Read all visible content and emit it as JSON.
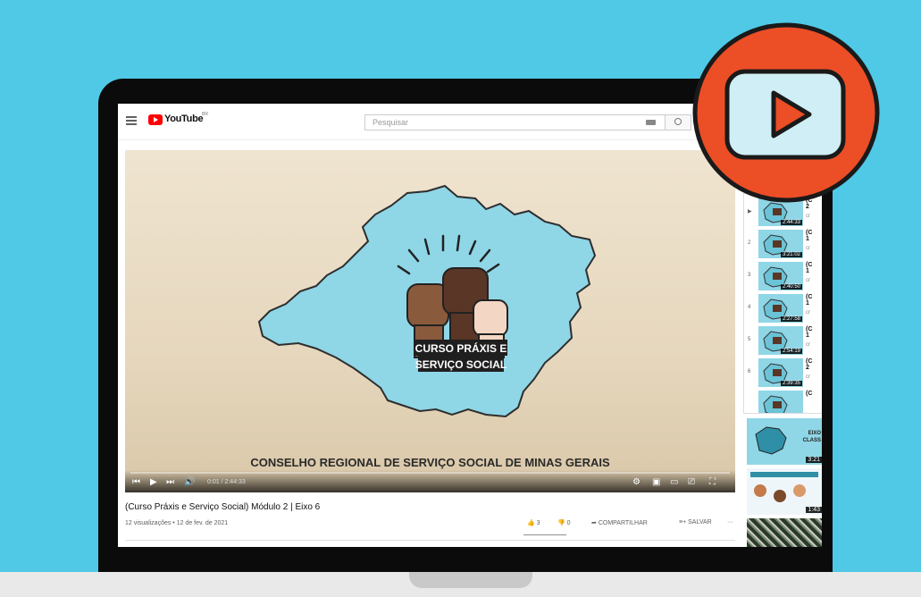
{
  "topbar": {
    "logo_text": "YouTube",
    "country_code": "BR",
    "search_placeholder": "Pesquisar"
  },
  "video": {
    "logo_text_line1": "CURSO PRÁXIS E",
    "logo_text_line2": "SERVIÇO SOCIAL",
    "caption": "CONSELHO REGIONAL DE SERVIÇO SOCIAL DE MINAS GERAIS",
    "time": "0:01 / 2:44:33",
    "progress": 0.0
  },
  "info": {
    "title": "(Curso Práxis e Serviço Social) Módulo 2 | Eixo 6",
    "meta": "12 visualizações • 12 de fev. de 2021",
    "likes": "3",
    "dislikes": "0",
    "share_label": "COMPARTILHAR",
    "save_label": "SALVAR",
    "more_label": "···"
  },
  "playlist": [
    {
      "num": "▶",
      "duration": "2:44:33",
      "title1": "(C",
      "title2": "2",
      "channel": "cr"
    },
    {
      "num": "2",
      "duration": "3:21:02",
      "title1": "(C",
      "title2": "1",
      "channel": "cr"
    },
    {
      "num": "3",
      "duration": "2:40:50",
      "title1": "(C",
      "title2": "1",
      "channel": "cr"
    },
    {
      "num": "4",
      "duration": "2:27:58",
      "title1": "(C",
      "title2": "1",
      "channel": "cr"
    },
    {
      "num": "5",
      "duration": "2:54:19",
      "title1": "(C",
      "title2": "1",
      "channel": "cr"
    },
    {
      "num": "6",
      "duration": "2:39:35",
      "title1": "(C",
      "title2": "2",
      "channel": "cr"
    },
    {
      "num": "",
      "duration": "",
      "title1": "(C",
      "title2": "",
      "channel": ""
    }
  ],
  "recommended": [
    {
      "duration": "3:21",
      "label1": "EIXO",
      "label2": "CLASS"
    },
    {
      "duration": "1:43",
      "label1": "",
      "label2": ""
    },
    {
      "duration": "",
      "label1": "",
      "label2": ""
    }
  ],
  "colors": {
    "background": "#4fc9e6",
    "youtube_red": "#ff0000",
    "badge_red": "#ec4e26",
    "map_teal": "#8fd6e6"
  }
}
